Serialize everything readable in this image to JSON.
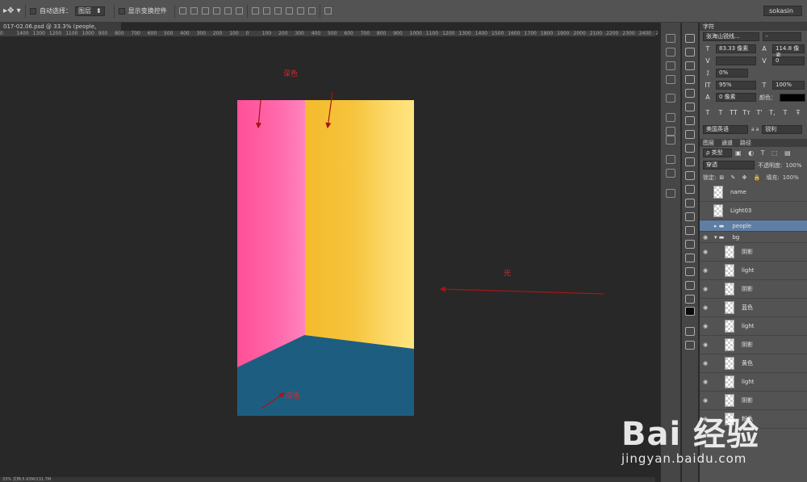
{
  "optionsBar": {
    "autoSelectLabel": "自动选择：",
    "autoSelectValue": "图层",
    "showTransformLabel": "显示变换控件",
    "workspace": "sokasin"
  },
  "document": {
    "tabTitle": "017-02.06.psd @ 33.3% (people, RGB/8) *",
    "rulerTicks": [
      "0",
      "1400",
      "1300",
      "1200",
      "1100",
      "1000",
      "900",
      "800",
      "700",
      "600",
      "500",
      "400",
      "300",
      "200",
      "100",
      "0",
      "100",
      "200",
      "300",
      "400",
      "500",
      "600",
      "700",
      "800",
      "900",
      "1000",
      "1100",
      "1200",
      "1300",
      "1400",
      "1500",
      "1600",
      "1700",
      "1800",
      "1900",
      "2000",
      "2100",
      "2200",
      "2300",
      "2400",
      "2"
    ],
    "status": "33% 文档:5.93M/131.7M"
  },
  "annotations": {
    "topLabel": "深色",
    "lightLabel": "光",
    "floorLabel": "深色"
  },
  "colors": {
    "pinkWall": "#ff5ea2",
    "yellowWall": "#f7c844",
    "floor": "#1d5e80",
    "annotation": "#d42b2b",
    "selectedLayer": "#5f7ea3"
  },
  "characterPanel": {
    "tabLabel": "字符",
    "fontFamily": "张海山锐线...",
    "fontStyle": "-",
    "fontSize": "83.33 像素",
    "leading": "114.8 像素",
    "kerning": "",
    "tracking": "0",
    "scalePercent": "0%",
    "verticalScale": "95%",
    "horizontalScale": "100%",
    "baselineShift": "0 像素",
    "colorLabel": "颜色：",
    "styleButtons": [
      "T",
      "T",
      "TT",
      "Tт",
      "T'",
      "T,",
      "T",
      "Ŧ"
    ],
    "language": "美国英语",
    "antialias": "锐利",
    "aaLabel": "a a"
  },
  "layersPanel": {
    "tabs": [
      "图层",
      "通道",
      "路径"
    ],
    "filterLabel": "ρ 类型",
    "blendMode": "穿透",
    "opacityLabel": "不透明度:",
    "opacityValue": "100%",
    "lockLabel": "锁定:",
    "fillLabel": "填充:",
    "fillValue": "100%",
    "layers": [
      {
        "name": "name"
      },
      {
        "name": "Light03"
      },
      {
        "name": "people"
      },
      {
        "name": "bg"
      },
      {
        "name": "阴影"
      },
      {
        "name": "light"
      },
      {
        "name": "阴影"
      },
      {
        "name": "蓝色"
      },
      {
        "name": "light"
      },
      {
        "name": "阴影"
      },
      {
        "name": "黄色"
      },
      {
        "name": "light"
      },
      {
        "name": "阴影"
      },
      {
        "name": "粉色"
      }
    ]
  },
  "watermark": {
    "brand": "Bai 经验",
    "url": "jingyan.baidu.com"
  }
}
